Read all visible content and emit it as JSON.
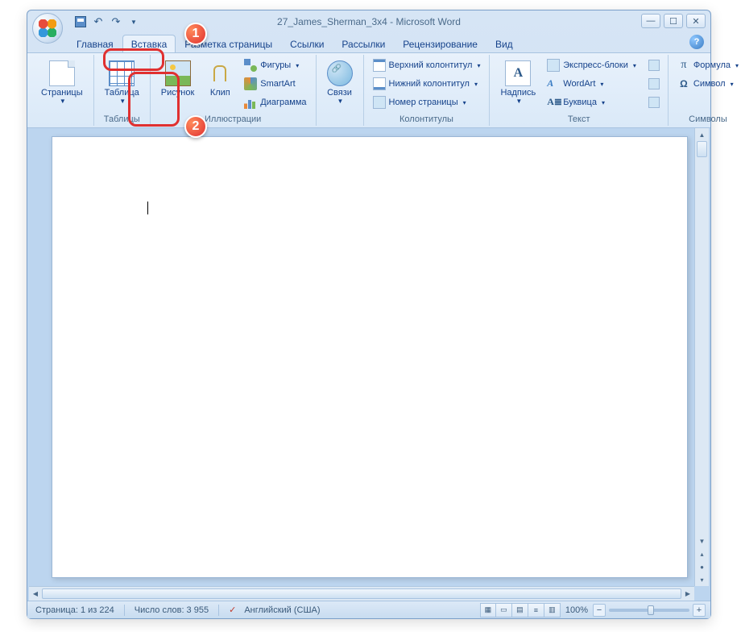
{
  "title": "27_James_Sherman_3x4 - Microsoft Word",
  "tabs": {
    "home": "Главная",
    "insert": "Вставка",
    "page_layout": "Разметка страницы",
    "references": "Ссылки",
    "mailings": "Рассылки",
    "review": "Рецензирование",
    "view": "Вид"
  },
  "ribbon": {
    "pages": {
      "label": "Страницы",
      "btn": "Страницы"
    },
    "tables": {
      "label": "Таблицы",
      "btn": "Таблица"
    },
    "illustrations": {
      "label": "Иллюстрации",
      "picture": "Рисунок",
      "clip": "Клип",
      "shapes": "Фигуры",
      "smartart": "SmartArt",
      "chart": "Диаграмма"
    },
    "links": {
      "label": "",
      "btn": "Связи"
    },
    "headers": {
      "label": "Колонтитулы",
      "header": "Верхний колонтитул",
      "footer": "Нижний колонтитул",
      "pagenum": "Номер страницы"
    },
    "text": {
      "label": "Текст",
      "textbox": "Надпись",
      "quickparts": "Экспресс-блоки",
      "wordart": "WordArt",
      "dropcap": "Буквица"
    },
    "symbols": {
      "label": "Символы",
      "formula": "Формула",
      "symbol": "Символ"
    }
  },
  "status": {
    "page": "Страница: 1 из 224",
    "words": "Число слов: 3 955",
    "lang": "Английский (США)",
    "zoom": "100%"
  },
  "callouts": {
    "one": "1",
    "two": "2"
  }
}
